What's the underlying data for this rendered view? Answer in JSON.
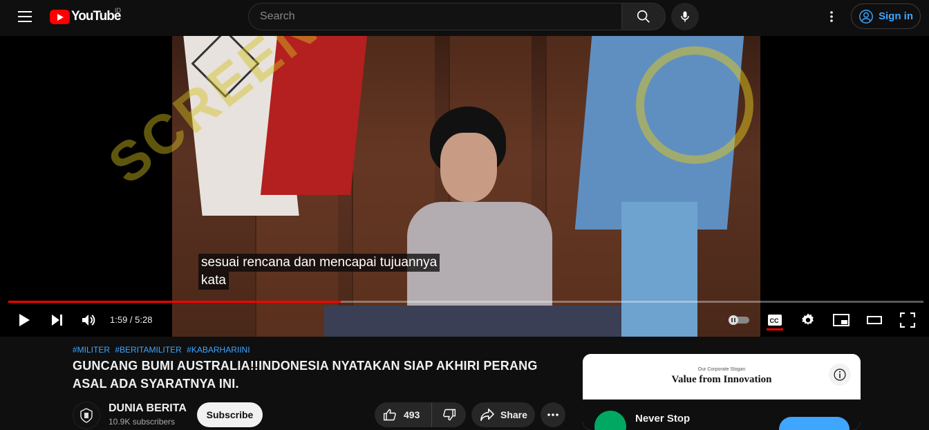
{
  "masthead": {
    "logo_text": "YouTube",
    "country_code": "ID",
    "search_placeholder": "Search",
    "signin_label": "Sign in"
  },
  "player": {
    "subtitle_lines": [
      "sesuai rencana dan mencapai tujuannya",
      "kata"
    ],
    "watermark_text": "SCREENSHOT BY",
    "current_time": "1:59",
    "duration": "5:28",
    "time_display": "1:59 / 5:28",
    "progress_fraction": 0.363,
    "cc_enabled": true,
    "autoplay_paused": true
  },
  "video": {
    "hashtags": [
      "#MILITER",
      "#BERITAMILITER",
      "#KABARHARIINI"
    ],
    "title": "GUNCANG BUMI AUSTRALIA!!INDONESIA NYATAKAN SIAP AKHIRI PERANG ASAL ADA SYARATNYA INI.",
    "channel_name": "DUNIA BERITA",
    "subscribers": "10.9K subscribers",
    "subscribe_label": "Subscribe",
    "like_count": "493",
    "share_label": "Share"
  },
  "ad": {
    "slogan": "Our Corporate Slogan",
    "headline": "Value from Innovation",
    "advertiser": "Never Stop"
  },
  "colors": {
    "background": "#0f0f0f",
    "accent_red": "#ff0000",
    "link_blue": "#3ea6ff"
  }
}
